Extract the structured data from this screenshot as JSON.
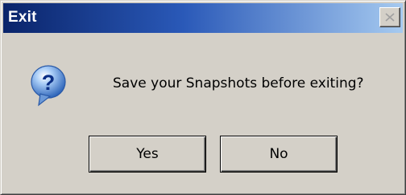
{
  "window": {
    "title": "Exit",
    "close_label": "Close"
  },
  "dialog": {
    "icon": "question-icon",
    "message": "Save your Snapshots before exiting?"
  },
  "buttons": {
    "yes_label": "Yes",
    "no_label": "No"
  },
  "colors": {
    "titlebar_start": "#0a246a",
    "titlebar_end": "#a6caf0",
    "dialog_bg": "#d4d0c8",
    "icon_bubble": "#4a86d8"
  }
}
